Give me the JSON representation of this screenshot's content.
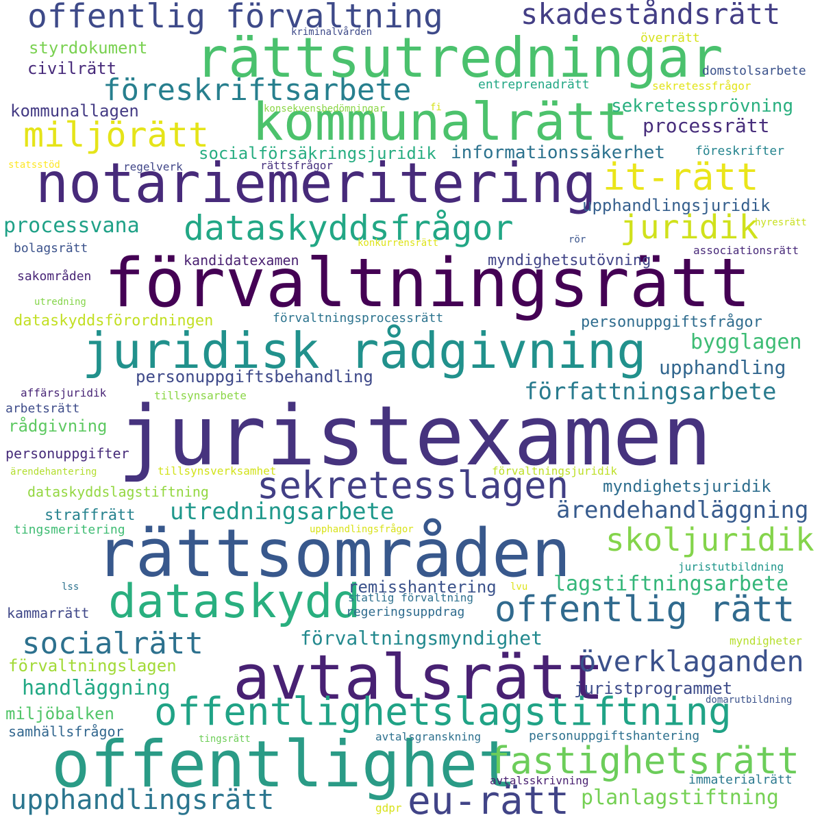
{
  "words": [
    {
      "text": "juristexamen",
      "color": "#46337e"
    },
    {
      "text": "förvaltningsrätt",
      "color": "#440154"
    },
    {
      "text": "rättsområden",
      "color": "#38588c"
    },
    {
      "text": "notariemeritering",
      "color": "#472a7a"
    },
    {
      "text": "rättsutredningar",
      "color": "#4ac16d"
    },
    {
      "text": "kommunalrätt",
      "color": "#4cc26c"
    },
    {
      "text": "juridisk rådgivning",
      "color": "#21918c"
    },
    {
      "text": "avtalsrätt",
      "color": "#482173"
    },
    {
      "text": "offentlighet",
      "color": "#2a9b86"
    },
    {
      "text": "offentlighetslagstiftning",
      "color": "#20a386"
    },
    {
      "text": "dataskydd",
      "color": "#29af7f"
    },
    {
      "text": "offentlig förvaltning",
      "color": "#3e4a89"
    },
    {
      "text": "sekretesslagen",
      "color": "#423f85"
    },
    {
      "text": "dataskyddsfrågor",
      "color": "#22a785"
    },
    {
      "text": "föreskriftsarbete",
      "color": "#277f8e"
    },
    {
      "text": "offentlig rätt",
      "color": "#306a8e"
    },
    {
      "text": "fastighetsrätt",
      "color": "#6ccd5a"
    },
    {
      "text": "eu-rätt",
      "color": "#414487"
    },
    {
      "text": "upphandlingsrätt",
      "color": "#2b758e"
    },
    {
      "text": "socialrätt",
      "color": "#2d718e"
    },
    {
      "text": "skadeståndsrätt",
      "color": "#433e85"
    },
    {
      "text": "skoljuridik",
      "color": "#84d44b"
    },
    {
      "text": "miljörätt",
      "color": "#e5e419"
    },
    {
      "text": "it-rätt",
      "color": "#eae51a"
    },
    {
      "text": "juridik",
      "color": "#d0e11c"
    },
    {
      "text": "överklaganden",
      "color": "#3b518b"
    },
    {
      "text": "författningsarbete",
      "color": "#297b8e"
    },
    {
      "text": "utredningsarbete",
      "color": "#1f988b"
    },
    {
      "text": "ärendehandläggning",
      "color": "#375b8d"
    },
    {
      "text": "lagstiftningsarbete",
      "color": "#34b679"
    },
    {
      "text": "förvaltningsmyndighet",
      "color": "#23898e"
    },
    {
      "text": "planlagstiftning",
      "color": "#75d054"
    },
    {
      "text": "processvana",
      "color": "#1fa187"
    },
    {
      "text": "handläggning",
      "color": "#22a884"
    },
    {
      "text": "bygglagen",
      "color": "#3dbc74"
    },
    {
      "text": "upphandling",
      "color": "#31668e"
    },
    {
      "text": "personuppgiftsbehandling",
      "color": "#3e4989"
    },
    {
      "text": "processrätt",
      "color": "#472d7b"
    },
    {
      "text": "sekretessprövning",
      "color": "#29af7f"
    },
    {
      "text": "informationssäkerhet",
      "color": "#2c728e"
    },
    {
      "text": "socialförsäkringsjuridik",
      "color": "#27ad81"
    },
    {
      "text": "upphandlingsjuridik",
      "color": "#355f8d"
    },
    {
      "text": "myndighetsjuridik",
      "color": "#2e6e8e"
    },
    {
      "text": "juristprogrammet",
      "color": "#3e4c8a"
    },
    {
      "text": "remisshantering",
      "color": "#3b528b"
    },
    {
      "text": "förvaltningslagen",
      "color": "#a2da37"
    },
    {
      "text": "miljöbalken",
      "color": "#52c569"
    },
    {
      "text": "styrdokument",
      "color": "#7ad151"
    },
    {
      "text": "civilrätt",
      "color": "#472a7a"
    },
    {
      "text": "kommunallagen",
      "color": "#443b84"
    },
    {
      "text": "rådgivning",
      "color": "#5ec962"
    },
    {
      "text": "straffrätt",
      "color": "#26828e"
    },
    {
      "text": "dataskyddsförordningen",
      "color": "#c2df23"
    },
    {
      "text": "dataskyddslagstiftning",
      "color": "#93d741"
    },
    {
      "text": "personuppgiftsfrågor",
      "color": "#2f6c8e"
    },
    {
      "text": "myndighetsutövning",
      "color": "#414487"
    },
    {
      "text": "kandidatexamen",
      "color": "#481f70"
    },
    {
      "text": "personuppgifter",
      "color": "#472c7a"
    },
    {
      "text": "kammarrätt",
      "color": "#3f4788"
    },
    {
      "text": "samhällsfrågor",
      "color": "#31668e"
    },
    {
      "text": "entreprenadrätt",
      "color": "#22a785"
    },
    {
      "text": "domstolsarbete",
      "color": "#3b528b"
    },
    {
      "text": "regeringsuppdrag",
      "color": "#2f6c8e"
    },
    {
      "text": "förvaltningsprocessrätt",
      "color": "#2c738e"
    },
    {
      "text": "personuppgiftshantering",
      "color": "#2d708e"
    },
    {
      "text": "föreskrifter",
      "color": "#25848e"
    },
    {
      "text": "bolagsrätt",
      "color": "#3b528b"
    },
    {
      "text": "arbetsrätt",
      "color": "#3e4c8a"
    },
    {
      "text": "sakområden",
      "color": "#482576"
    },
    {
      "text": "associationsrätt",
      "color": "#482979"
    },
    {
      "text": "avtalsgranskning",
      "color": "#2d708e"
    },
    {
      "text": "avtalsskrivning",
      "color": "#481f70"
    },
    {
      "text": "immaterialrätt",
      "color": "#2a788e"
    },
    {
      "text": "regelverk",
      "color": "#404688"
    },
    {
      "text": "rättsfrågor",
      "color": "#46307e"
    },
    {
      "text": "affärsjuridik",
      "color": "#482576"
    },
    {
      "text": "juristutbildning",
      "color": "#1f968b"
    },
    {
      "text": "statlig förvaltning",
      "color": "#2d708e"
    },
    {
      "text": "domarutbildning",
      "color": "#3b528b"
    },
    {
      "text": "myndigheter",
      "color": "#b5de2b"
    },
    {
      "text": "tingsmeritering",
      "color": "#3fbc73"
    },
    {
      "text": "tingsrätt",
      "color": "#6ece58"
    },
    {
      "text": "upphandlingsfrågor",
      "color": "#d8e219"
    },
    {
      "text": "förvaltningsjuridik",
      "color": "#bddf26"
    },
    {
      "text": "tillsynsverksamhet",
      "color": "#d2e21b"
    },
    {
      "text": "tillsynsarbete",
      "color": "#8bd646"
    },
    {
      "text": "ärendehantering",
      "color": "#b2dd2d"
    },
    {
      "text": "utredning",
      "color": "#85d54a"
    },
    {
      "text": "konkurrensrätt",
      "color": "#dde318"
    },
    {
      "text": "sekretessfrågor",
      "color": "#e2e418"
    },
    {
      "text": "konsekvensbedömningar",
      "color": "#8bd646"
    },
    {
      "text": "hyresrätt",
      "color": "#c8e020"
    },
    {
      "text": "statsstöd",
      "color": "#fde725"
    },
    {
      "text": "överrätt",
      "color": "#d5e21a"
    },
    {
      "text": "kriminalvården",
      "color": "#3e4a89"
    },
    {
      "text": "fi",
      "color": "#d5e21a"
    },
    {
      "text": "lvu",
      "color": "#dde318"
    },
    {
      "text": "gdpr",
      "color": "#d8e219"
    },
    {
      "text": "rör",
      "color": "#3a548c"
    },
    {
      "text": "lss",
      "color": "#2c728e"
    }
  ]
}
